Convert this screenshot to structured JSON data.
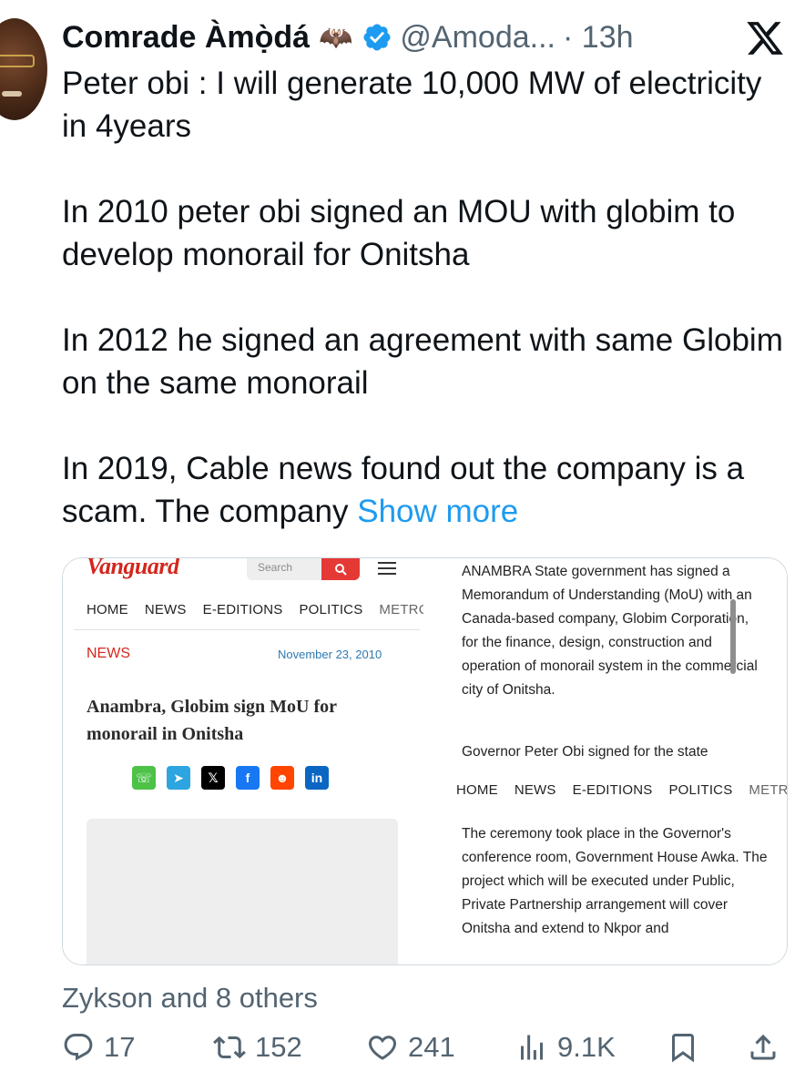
{
  "tweet": {
    "author_name": "Comrade Àmọ̀dá",
    "author_emoji": "🦇",
    "handle": "@Amoda...",
    "time": "· 13h",
    "paragraphs": [
      "Peter obi : I will generate 10,000 MW of electricity in 4years",
      "In 2010 peter obi signed an MOU with globim to develop monorail for Onitsha",
      "In 2012 he signed an agreement with same Globim on the same monorail",
      "In 2019, Cable news found out the company is a scam. The company"
    ],
    "show_more": "Show more"
  },
  "media": {
    "left": {
      "brand": "Vanguard",
      "search_placeholder": "Search",
      "nav": [
        "HOME",
        "NEWS",
        "E-EDITIONS",
        "POLITICS",
        "METRO"
      ],
      "category": "NEWS",
      "date": "November 23, 2010",
      "title": "Anambra, Globim sign MoU for monorail in Onitsha",
      "share_icons": [
        "whatsapp-icon",
        "telegram-icon",
        "x-icon",
        "facebook-icon",
        "reddit-icon",
        "linkedin-icon"
      ],
      "share_glyphs": [
        "☏",
        "➤",
        "𝕏",
        "f",
        "☻",
        "in"
      ],
      "share_colors": [
        "#4dc247",
        "#2ca5e0",
        "#000000",
        "#1877f2",
        "#ff4500",
        "#0a66c2"
      ]
    },
    "right": {
      "paragraph_top": "ANAMBRA State government has signed a Memorandum of Understanding (MoU) with an Canada-based company, Globim Corporation, for the finance, design, construction and operation of monorail system in the commercial city of Onitsha.",
      "paragraph_gov": "Governor Peter Obi signed for the state",
      "nav": [
        "HOME",
        "NEWS",
        "E-EDITIONS",
        "POLITICS",
        "METRO"
      ],
      "paragraph_bottom": "The ceremony took place in the Governor's conference room, Government House Awka. The project which will be executed under Public, Private Partnership arrangement will cover Onitsha and extend to Nkpor and"
    }
  },
  "engagement": {
    "liked_by": "Zykson and 8 others",
    "replies": "17",
    "retweets": "152",
    "likes": "241",
    "views": "9.1K"
  },
  "colors": {
    "link_blue": "#1d9bf0",
    "verified_blue": "#1d9bf0",
    "secondary_gray": "#536471",
    "vanguard_red": "#d4261c"
  }
}
